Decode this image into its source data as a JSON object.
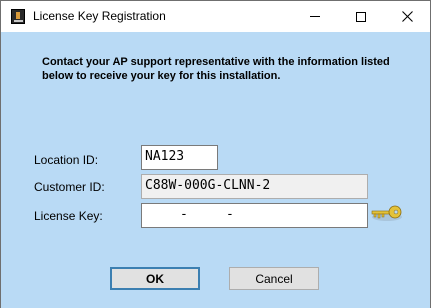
{
  "window": {
    "title": "License Key Registration",
    "controls": {
      "minimize": "minimize",
      "maximize": "maximize",
      "close": "close"
    }
  },
  "message": "Contact your AP support representative with the information listed below to receive your key for this installation.",
  "form": {
    "location_id": {
      "label": "Location ID:",
      "value": "NA123"
    },
    "customer_id": {
      "label": "Customer ID:",
      "value": "C88W-000G-CLNN-2"
    },
    "license_key": {
      "label": "License Key:",
      "separators": [
        "-",
        "-"
      ]
    }
  },
  "buttons": {
    "ok": "OK",
    "cancel": "Cancel"
  },
  "icons": {
    "app": "app-icon",
    "key": "key-icon"
  },
  "colors": {
    "client_background": "#b9daf5",
    "key_gold": "#e3c23a",
    "ok_border": "#3c7fb1"
  }
}
